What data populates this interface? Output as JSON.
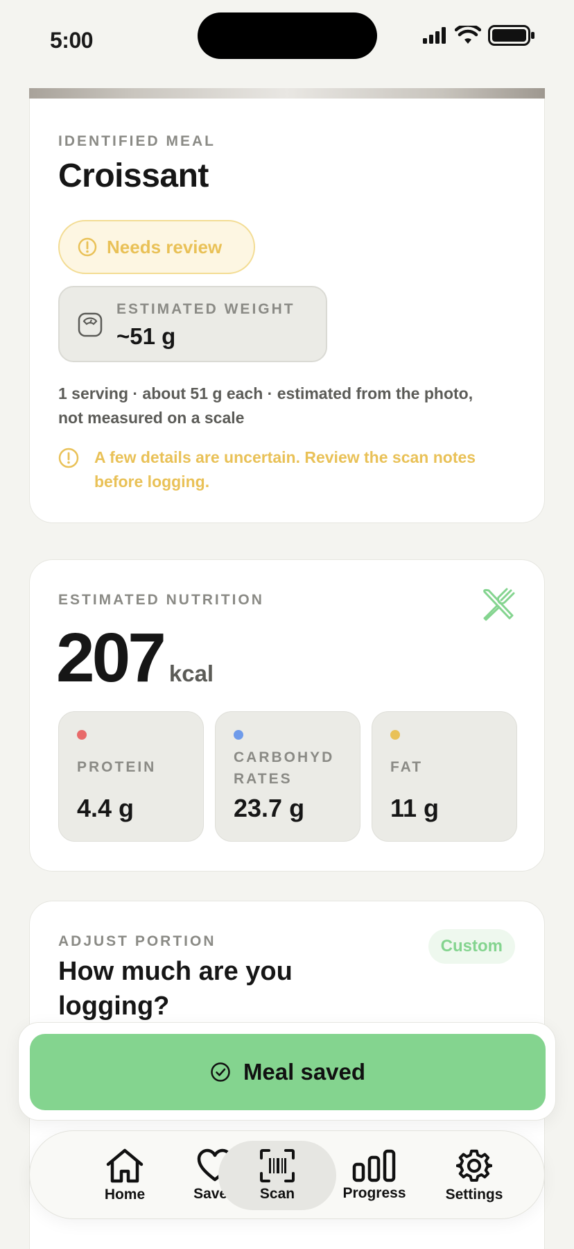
{
  "status": {
    "time": "5:00"
  },
  "meal": {
    "eyebrow": "IDENTIFIED MEAL",
    "name": "Croissant",
    "badge": "Needs review",
    "weight_label": "ESTIMATED WEIGHT",
    "weight_value": "~51 g",
    "description": "1 serving · about 51 g each · estimated from the photo, not measured on a scale",
    "warning": "A few details are uncertain. Review the scan notes before logging."
  },
  "nutrition": {
    "eyebrow": "ESTIMATED NUTRITION",
    "kcal": "207",
    "kcal_unit": "kcal",
    "macros": [
      {
        "label": "PROTEIN",
        "value": "4.4 g",
        "color": "#e86a6a"
      },
      {
        "label": "CARBOHYD RATES",
        "value": "23.7 g",
        "color": "#6f9bea"
      },
      {
        "label": "FAT",
        "value": "11 g",
        "color": "#e9c157"
      }
    ]
  },
  "portion": {
    "eyebrow": "ADJUST PORTION",
    "badge": "Custom",
    "question": "How much are you logging?"
  },
  "save_button": {
    "label": "Meal saved",
    "color": "#84d48f"
  },
  "nav": {
    "items": [
      {
        "label": "Home",
        "icon": "home-icon"
      },
      {
        "label": "Saved",
        "icon": "heart-icon"
      },
      {
        "label": "Scan",
        "icon": "barcode-scan-icon"
      },
      {
        "label": "Progress",
        "icon": "bar-chart-icon"
      },
      {
        "label": "Settings",
        "icon": "gear-icon"
      }
    ]
  }
}
